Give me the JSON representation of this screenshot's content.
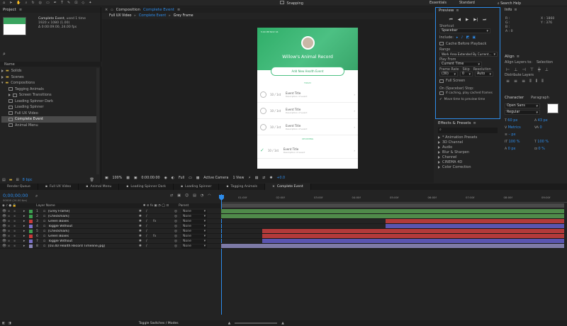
{
  "menubar": {
    "workspaces": [
      "Essentials",
      "Standard"
    ],
    "snapping": "Snapping",
    "search_placeholder": "Search Help"
  },
  "project": {
    "panel_title": "Project",
    "comp_name": "Complete Event",
    "comp_uses": ", used 1 time",
    "comp_size": "1920 x 1080 (1.00)",
    "comp_duration": "Δ 0:00:09:00, 24.00 fps",
    "column_name": "Name",
    "folders": [
      "Solids",
      "Scenes",
      "Compositions"
    ],
    "comps": [
      "Tagging Animals",
      "Screen Transitions",
      "Loading Spinner Dark",
      "Loading Spinner",
      "Full UX Video",
      "Complete Event",
      "Animal Menu"
    ],
    "bpc": "8 bpc"
  },
  "viewer": {
    "panel_title": "Composition",
    "comp_name": "Complete Event",
    "crumbs": [
      "Full UX Video",
      "Complete Event",
      "Grey Frame"
    ],
    "zoom": "100%",
    "timecode": "0:00:00:00",
    "resolution": "Full",
    "camera": "Active Camera",
    "views": "1 View",
    "exposure": "+0.0"
  },
  "phone": {
    "topbar": "5:00 PM NOV 16",
    "title": "Willow's Animal Record",
    "button": "Add New Health Event",
    "section_today": "TODAY",
    "section_later": "UPCOMING",
    "events": [
      {
        "time": "10 / 1st",
        "title": "Event Title",
        "sub": "Description of event",
        "checked": false
      },
      {
        "time": "10 / 1st",
        "title": "Event Title",
        "sub": "Description of event",
        "checked": false
      },
      {
        "time": "10 / 1st",
        "title": "Event Title",
        "sub": "Description of event",
        "checked": false
      },
      {
        "time": "10 / 1st",
        "title": "Event Title",
        "sub": "Description of event",
        "checked": true
      }
    ]
  },
  "preview": {
    "panel_title": "Preview",
    "shortcut_label": "Shortcut",
    "shortcut_value": "Spacebar",
    "include_label": "Include:",
    "cache": "Cache Before Playback",
    "range_label": "Range",
    "range_value": "Work Area Extended By Current...",
    "play_from_label": "Play From",
    "play_from_value": "Current Time",
    "fr_label": "Frame Rate",
    "skip_label": "Skip",
    "res_label": "Resolution",
    "fr_value": "(30)",
    "skip_value": "0",
    "res_value": "Auto",
    "fullscreen": "Full Screen",
    "stop_label": "On (Spacebar) Stop:",
    "stop_opt1": "If caching, play cached frames",
    "stop_opt2": "Move time to preview time"
  },
  "effects": {
    "panel_title": "Effects & Presets",
    "items": [
      "* Animation Presets",
      "3D Channel",
      "Audio",
      "Blur & Sharpen",
      "Channel",
      "CINEMA 4D",
      "Color Correction"
    ]
  },
  "info": {
    "panel_title": "Info",
    "r": "R :",
    "g": "G :",
    "b": "B :",
    "a": "A : 0",
    "x": "X : 1860",
    "y": "Y : 376"
  },
  "align": {
    "panel_title": "Align",
    "align_to_label": "Align Layers to:",
    "align_to_value": "Selection",
    "distribute": "Distribute Layers"
  },
  "character": {
    "panel_title": "Character",
    "tab2": "Paragraph",
    "font": "Open Sans",
    "style": "Regular",
    "size": "60 px",
    "leading": "43 px",
    "tracking": "0",
    "metrics": "Metrics",
    "stroke": "– px",
    "vscale": "100 %",
    "hscale": "100 %",
    "baseline": "0 px",
    "tsume": "0 %"
  },
  "timeline": {
    "tabs": [
      "Render Queue",
      "Full UX Video",
      "Animal Menu",
      "Loading Spinner Dark",
      "Loading Spinner",
      "Tagging Animals",
      "Complete Event"
    ],
    "timecode": "0;00;00;00",
    "fps_note": "00000 (24.00 fps)",
    "layer_name_header": "Layer Name",
    "parent_header": "Parent",
    "ruler": [
      "01:00f",
      "02:00f",
      "03:00f",
      "04:00f",
      "05:00f",
      "06:00f",
      "07:00f",
      "08:00f",
      "09:00f"
    ],
    "layers": [
      {
        "num": "1",
        "name": "[Grey Frame]",
        "color": "#3c9f4f",
        "parent": "None"
      },
      {
        "num": "2",
        "name": "[Checkmark]",
        "color": "#3c9f4f",
        "parent": "None"
      },
      {
        "num": "3",
        "name": "Green Boxes",
        "color": "#c83a3a",
        "parent": "None"
      },
      {
        "num": "4",
        "name": "Toggle Without",
        "color": "#7a6fc6",
        "parent": "None"
      },
      {
        "num": "5",
        "name": "[Checkmark]",
        "color": "#3c9f4f",
        "parent": "None"
      },
      {
        "num": "6",
        "name": "Green Boxes",
        "color": "#c83a3a",
        "parent": "None"
      },
      {
        "num": "7",
        "name": "Toggle Without",
        "color": "#7a6fc6",
        "parent": "None"
      },
      {
        "num": "8",
        "name": "[03.40 Health Record Timeline.jpg]",
        "color": "#8a86b8",
        "parent": "None"
      }
    ],
    "bars": [
      {
        "start": 0.0,
        "end": 1.0,
        "color": "#4f8a4a"
      },
      {
        "start": 0.0,
        "end": 1.0,
        "color": "#4f8a4a"
      },
      {
        "start": 0.48,
        "end": 1.0,
        "color": "#b23a3a"
      },
      {
        "start": 0.48,
        "end": 1.0,
        "color": "#5a55b0"
      },
      {
        "start": 0.12,
        "end": 1.0,
        "color": "#b23a3a"
      },
      {
        "start": 0.12,
        "end": 1.0,
        "color": "#b23a3a"
      },
      {
        "start": 0.12,
        "end": 1.0,
        "color": "#5a55b0"
      },
      {
        "start": 0.0,
        "end": 1.0,
        "color": "#7d7aa6"
      }
    ],
    "toggle": "Toggle Switches / Modes"
  }
}
